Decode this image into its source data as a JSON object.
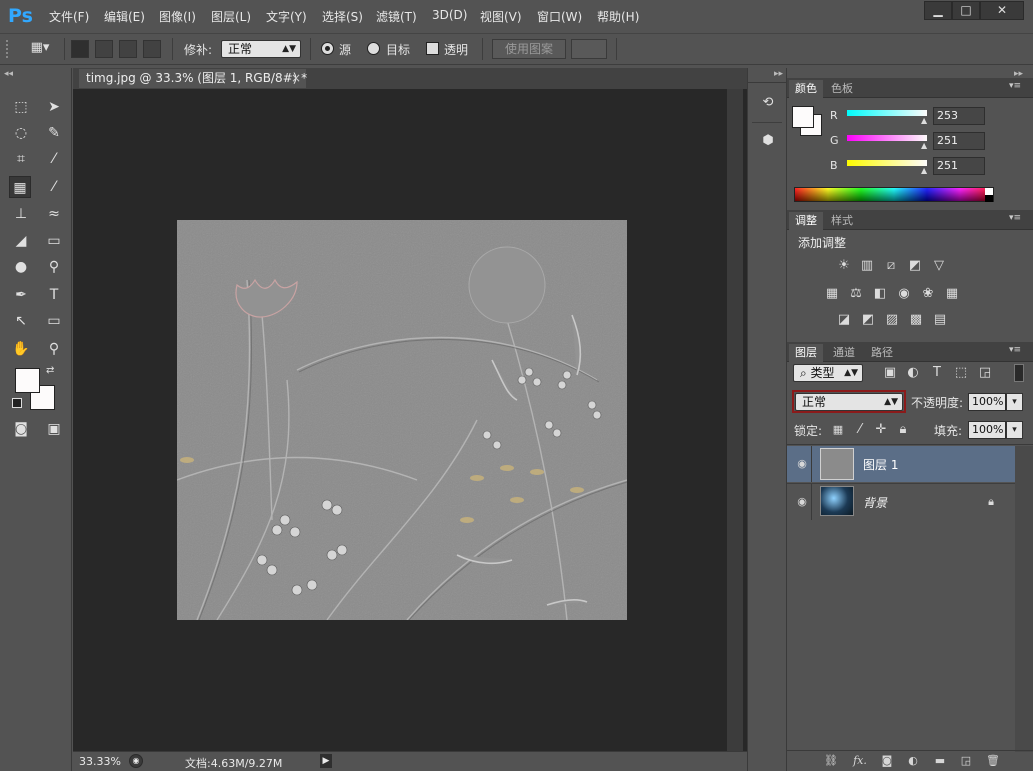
{
  "app": {
    "logo": "Ps"
  },
  "menu": [
    "文件(F)",
    "编辑(E)",
    "图像(I)",
    "图层(L)",
    "文字(Y)",
    "选择(S)",
    "滤镜(T)",
    "3D(D)",
    "视图(V)",
    "窗口(W)",
    "帮助(H)"
  ],
  "window_controls": {
    "minimize": "▁",
    "maximize": "□",
    "close": "✕"
  },
  "options": {
    "patch_label": "修补:",
    "patch_mode": "正常",
    "source_label": "源",
    "target_label": "目标",
    "transparent_label": "透明",
    "use_pattern_label": "使用图案"
  },
  "document": {
    "tab_title": "timg.jpg @ 33.3% (图层 1, RGB/8#) *",
    "tab_close": "×",
    "zoom": "33.33%",
    "doc_info": "文档:4.63M/9.27M"
  },
  "color_panel": {
    "tabs": [
      "颜色",
      "色板"
    ],
    "r_label": "R",
    "g_label": "G",
    "b_label": "B",
    "r": "253",
    "g": "251",
    "b": "251"
  },
  "adjust_panel": {
    "tabs": [
      "调整",
      "样式"
    ],
    "title": "添加调整"
  },
  "layers_panel": {
    "tabs": [
      "图层",
      "通道",
      "路径"
    ],
    "filter_type": "类型",
    "blend_mode": "正常",
    "opacity_label": "不透明度:",
    "opacity": "100%",
    "lock_label": "锁定:",
    "fill_label": "填充:",
    "fill": "100%",
    "layers": [
      {
        "name": "图层 1",
        "selected": true
      },
      {
        "name": "背景",
        "selected": false
      }
    ]
  },
  "colors": {
    "accent_blue": "#31a8ff",
    "selected_layer": "#5b6e87",
    "blend_highlight": "#8b1a1a"
  }
}
